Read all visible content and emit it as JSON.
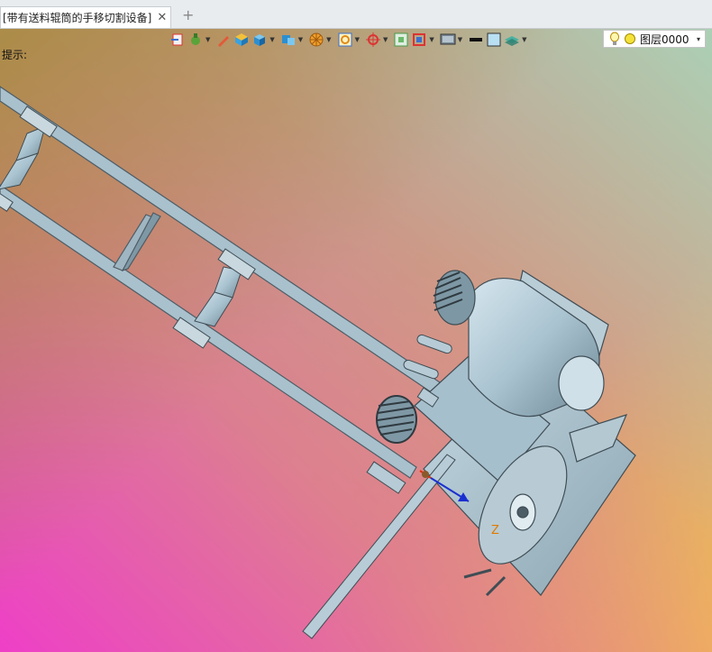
{
  "tabs": {
    "doc_title": "[带有送料辊筒的手移切割设备]",
    "close_symbol": "✕",
    "add_symbol": "+"
  },
  "hint": {
    "label": "提示:"
  },
  "toolbar": {
    "icons": [
      "import-icon",
      "fill-icon",
      "pen-icon",
      "box-icon",
      "solid-icon",
      "view-cube-icon",
      "wheel-icon",
      "zoom-window-icon",
      "crosshair-icon",
      "fit-view-icon",
      "section-icon",
      "display-mode-icon",
      "line-style-icon",
      "color-swatch-icon",
      "layers-icon",
      "lightbulb-icon"
    ]
  },
  "layer": {
    "value": "图层0000",
    "dropdown_symbol": "▾"
  },
  "colors": {
    "frame": "#9fb9c8",
    "frame_dark": "#4d5d66",
    "motor": "#a9c3d0",
    "axis_x": "#e03010",
    "axis_y": "#1c9e2a",
    "axis_z": "#1a2fd0"
  }
}
